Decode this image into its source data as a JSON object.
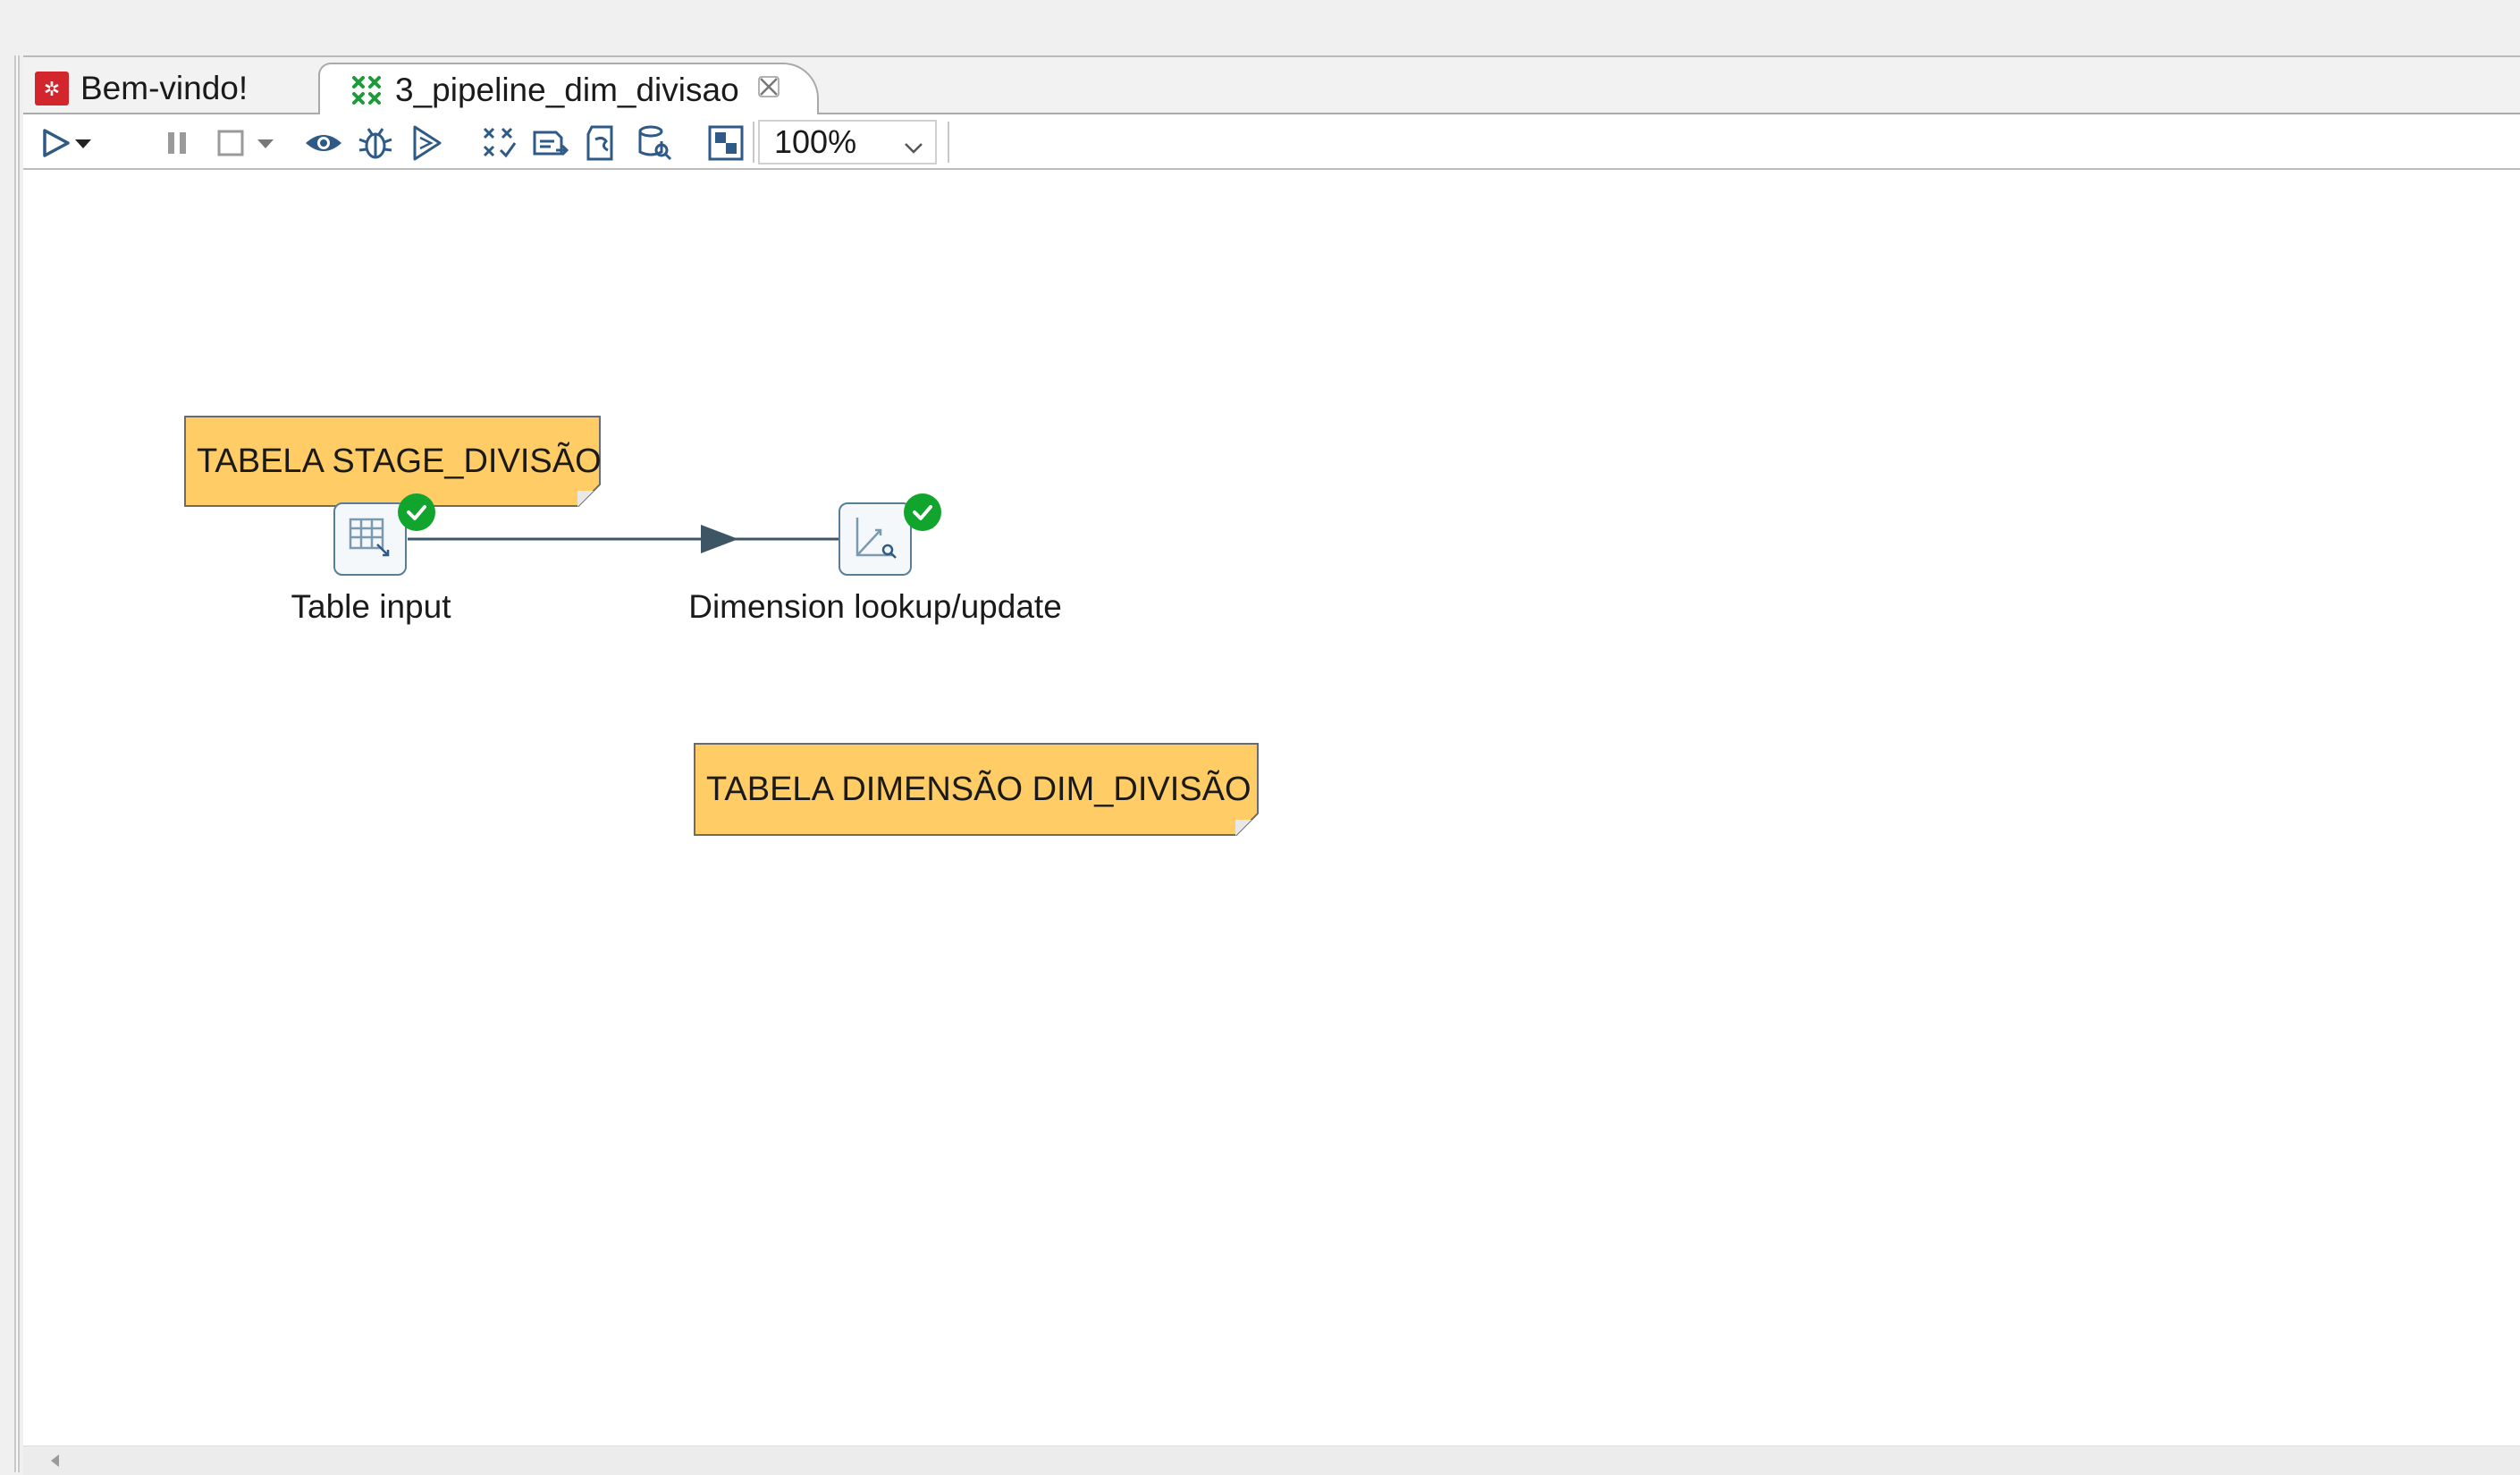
{
  "tabs": [
    {
      "label": "Bem-vindo!",
      "icon": "pentaho-welcome-icon"
    },
    {
      "label": "3_pipeline_dim_divisao",
      "icon": "transformation-icon",
      "close_icon": "close-icon",
      "active": true
    }
  ],
  "toolbar": {
    "buttons": [
      "run-icon",
      "run-dropdown-icon",
      "pause-icon",
      "stop-icon",
      "stop-dropdown-icon",
      "preview-icon",
      "debug-icon",
      "replay-icon",
      "verify-icon",
      "impact-icon",
      "sql-icon",
      "explore-db-icon",
      "grid-toggle-icon"
    ],
    "zoom": {
      "value": "100%"
    }
  },
  "canvas": {
    "notes": [
      {
        "text": "TABELA STAGE_DIVISÃO"
      },
      {
        "text": "TABELA DIMENSÃO DIM_DIVISÃO"
      }
    ],
    "steps": [
      {
        "label": "Table input",
        "icon": "table-input-icon",
        "status": "ok"
      },
      {
        "label": "Dimension lookup/update",
        "icon": "dimension-lookup-icon",
        "status": "ok"
      }
    ]
  },
  "colors": {
    "note_fill": "#ffcc66",
    "ok_badge": "#12a52d",
    "hop": "#3e5566",
    "step_border": "#5a7d96"
  }
}
